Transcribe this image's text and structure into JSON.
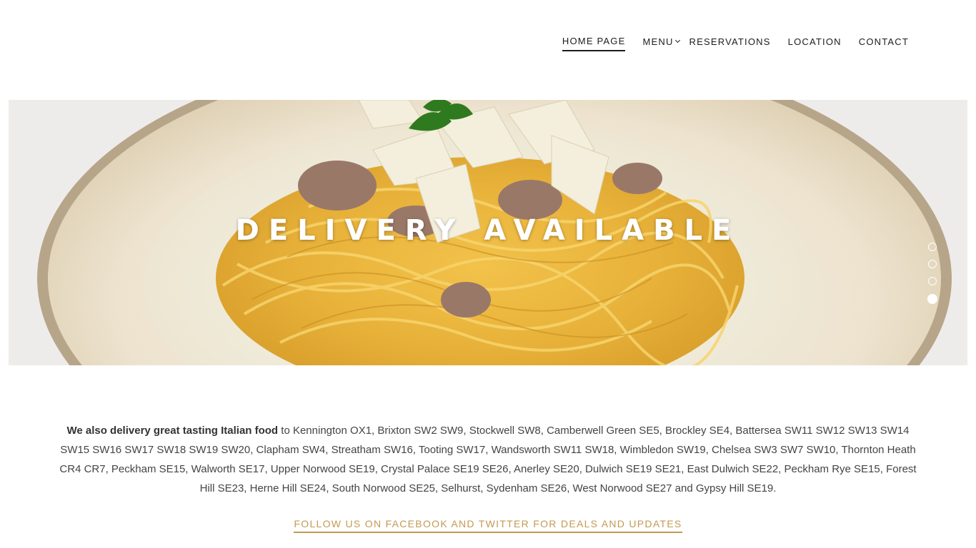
{
  "nav": {
    "items": [
      {
        "label": "HOME PAGE",
        "active": true
      },
      {
        "label": "MENU",
        "has_dropdown": true
      },
      {
        "label": "RESERVATIONS"
      },
      {
        "label": "LOCATION"
      },
      {
        "label": "CONTACT"
      }
    ]
  },
  "hero": {
    "title": "DELIVERY AVAILABLE",
    "image": "pasta-dish-photo",
    "slides": 4,
    "active_slide": 4
  },
  "content": {
    "intro_bold": "We also delivery great tasting Italian food",
    "intro_rest": " to Kennington OX1, Brixton SW2 SW9, Stockwell SW8, Camberwell Green SE5, Brockley SE4,  Battersea SW11 SW12 SW13 SW14 SW15 SW16 SW17 SW18 SW19 SW20, Clapham SW4, Streatham SW16, Tooting SW17, Wandsworth SW11 SW18, Wimbledon SW19, Chelsea SW3 SW7 SW10, Thornton Heath CR4 CR7, Peckham SE15, Walworth SE17, Upper Norwood SE19, Crystal Palace SE19 SE26, Anerley SE20, Dulwich SE19 SE21, East Dulwich SE22, Peckham Rye SE15, Forest Hill SE23, Herne Hill SE24, South Norwood SE25, Selhurst, Sydenham SE26, West Norwood SE27 and Gypsy Hill SE19.",
    "follow_link": "FOLLOW US ON FACEBOOK AND TWITTER FOR DEALS AND UPDATES"
  },
  "colors": {
    "accent": "#c49a52",
    "nav_text": "#1c1c1c",
    "body_text": "#444444"
  }
}
